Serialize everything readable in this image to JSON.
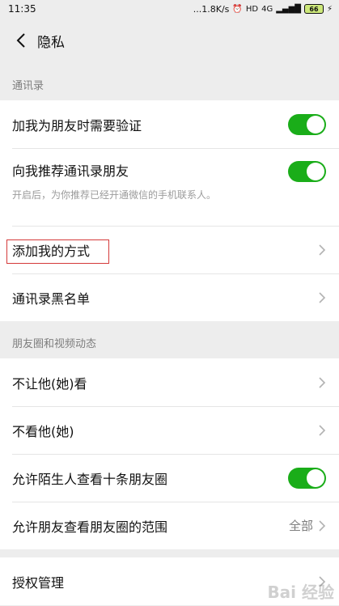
{
  "status_bar": {
    "time": "11:35",
    "speed": "...1.8K/s",
    "alarm_icon": "alarm-clock-icon",
    "hd": "HD",
    "signal": "4G",
    "battery": "66",
    "charging_icon": "bolt-icon"
  },
  "nav": {
    "title": "隐私",
    "back_icon": "chevron-left-icon"
  },
  "sections": {
    "contacts_header": "通讯录",
    "moments_header": "朋友圈和视频动态"
  },
  "rows": {
    "verify": {
      "label": "加我为朋友时需要验证",
      "toggle": true
    },
    "recommend": {
      "label": "向我推荐通讯录朋友",
      "desc": "开启后，为你推荐已经开通微信的手机联系人。",
      "toggle": true
    },
    "add_methods": {
      "label": "添加我的方式"
    },
    "blacklist": {
      "label": "通讯录黑名单"
    },
    "hide_from": {
      "label": "不让他(她)看"
    },
    "not_see": {
      "label": "不看他(她)"
    },
    "strangers": {
      "label": "允许陌生人查看十条朋友圈",
      "toggle": true
    },
    "range": {
      "label": "允许朋友查看朋友圈的范围",
      "value": "全部"
    },
    "auth": {
      "label": "授权管理"
    }
  },
  "colors": {
    "toggle_on": "#1aad19",
    "highlight": "#d43a3a"
  },
  "watermark": "Bai 经验"
}
